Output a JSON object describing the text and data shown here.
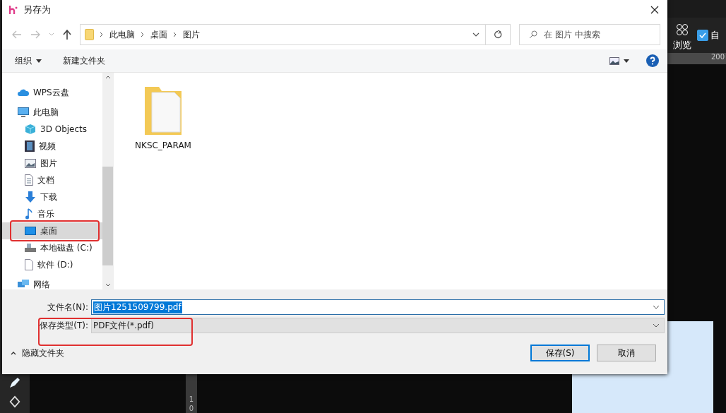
{
  "window": {
    "title": "另存为"
  },
  "nav": {
    "breadcrumb": [
      "此电脑",
      "桌面",
      "图片"
    ],
    "search": {
      "placeholder": "在 图片 中搜索"
    }
  },
  "toolbar": {
    "organize": "组织",
    "new_folder": "新建文件夹"
  },
  "sidebar": {
    "items": [
      {
        "label": "WPS云盘",
        "kind": "cloud",
        "selected": false
      },
      {
        "label": "此电脑",
        "kind": "computer",
        "selected": false,
        "children": [
          {
            "label": "3D Objects",
            "kind": "cube",
            "selected": false
          },
          {
            "label": "视频",
            "kind": "video",
            "selected": false
          },
          {
            "label": "图片",
            "kind": "picture",
            "selected": false
          },
          {
            "label": "文档",
            "kind": "document",
            "selected": false
          },
          {
            "label": "下载",
            "kind": "download",
            "selected": false
          },
          {
            "label": "音乐",
            "kind": "music",
            "selected": false
          },
          {
            "label": "桌面",
            "kind": "desktop",
            "selected": true
          },
          {
            "label": "本地磁盘 (C:)",
            "kind": "drive",
            "selected": false
          },
          {
            "label": "软件 (D:)",
            "kind": "file",
            "selected": false
          }
        ]
      },
      {
        "label": "网络",
        "kind": "network",
        "selected": false
      }
    ]
  },
  "files": [
    {
      "name": "NKSC_PARAM",
      "kind": "folder"
    }
  ],
  "form": {
    "file_name": {
      "label": "文件名(N):",
      "value": "图片1251509799.pdf",
      "selected": true
    },
    "file_type": {
      "label": "保存类型(T):",
      "value": "PDF文件(*.pdf)"
    }
  },
  "footer": {
    "hide_folders": "隐藏文件夹",
    "buttons": [
      {
        "label": "保存(S)",
        "kind": "primary"
      },
      {
        "label": "取消",
        "kind": "secondary"
      }
    ]
  },
  "background_app": {
    "browse_label": "浏览",
    "checkbox": {
      "label": "自",
      "checked": true
    },
    "ruler_label": "200",
    "vertical_ruler": [
      "1",
      "0"
    ]
  }
}
